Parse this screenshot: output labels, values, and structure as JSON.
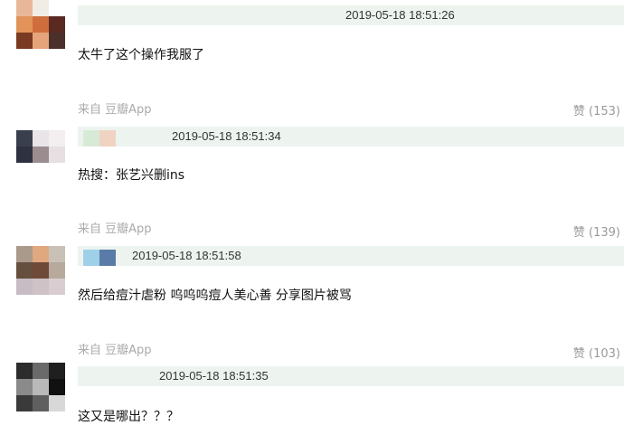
{
  "comments": [
    {
      "timestamp": "2019-05-18 18:51:26",
      "text": "太牛了这个操作我服了",
      "source": "来自 豆瓣App",
      "like": "赞 (153)"
    },
    {
      "timestamp": "2019-05-18 18:51:34",
      "text": "热搜：张艺兴删ins",
      "source": "来自 豆瓣App",
      "like": "赞 (139)"
    },
    {
      "timestamp": "2019-05-18 18:51:58",
      "text": "然后给痘汁虐粉 呜呜呜痘人美心善 分享图片被骂",
      "source": "来自 豆瓣App",
      "like": "赞 (103)"
    },
    {
      "timestamp": "2019-05-18 18:51:35",
      "text": "这又是哪出？？？"
    }
  ],
  "colors": {
    "header_bg": "#edf4ef",
    "source_text": "#aaaaaa",
    "like_text": "#999999"
  }
}
